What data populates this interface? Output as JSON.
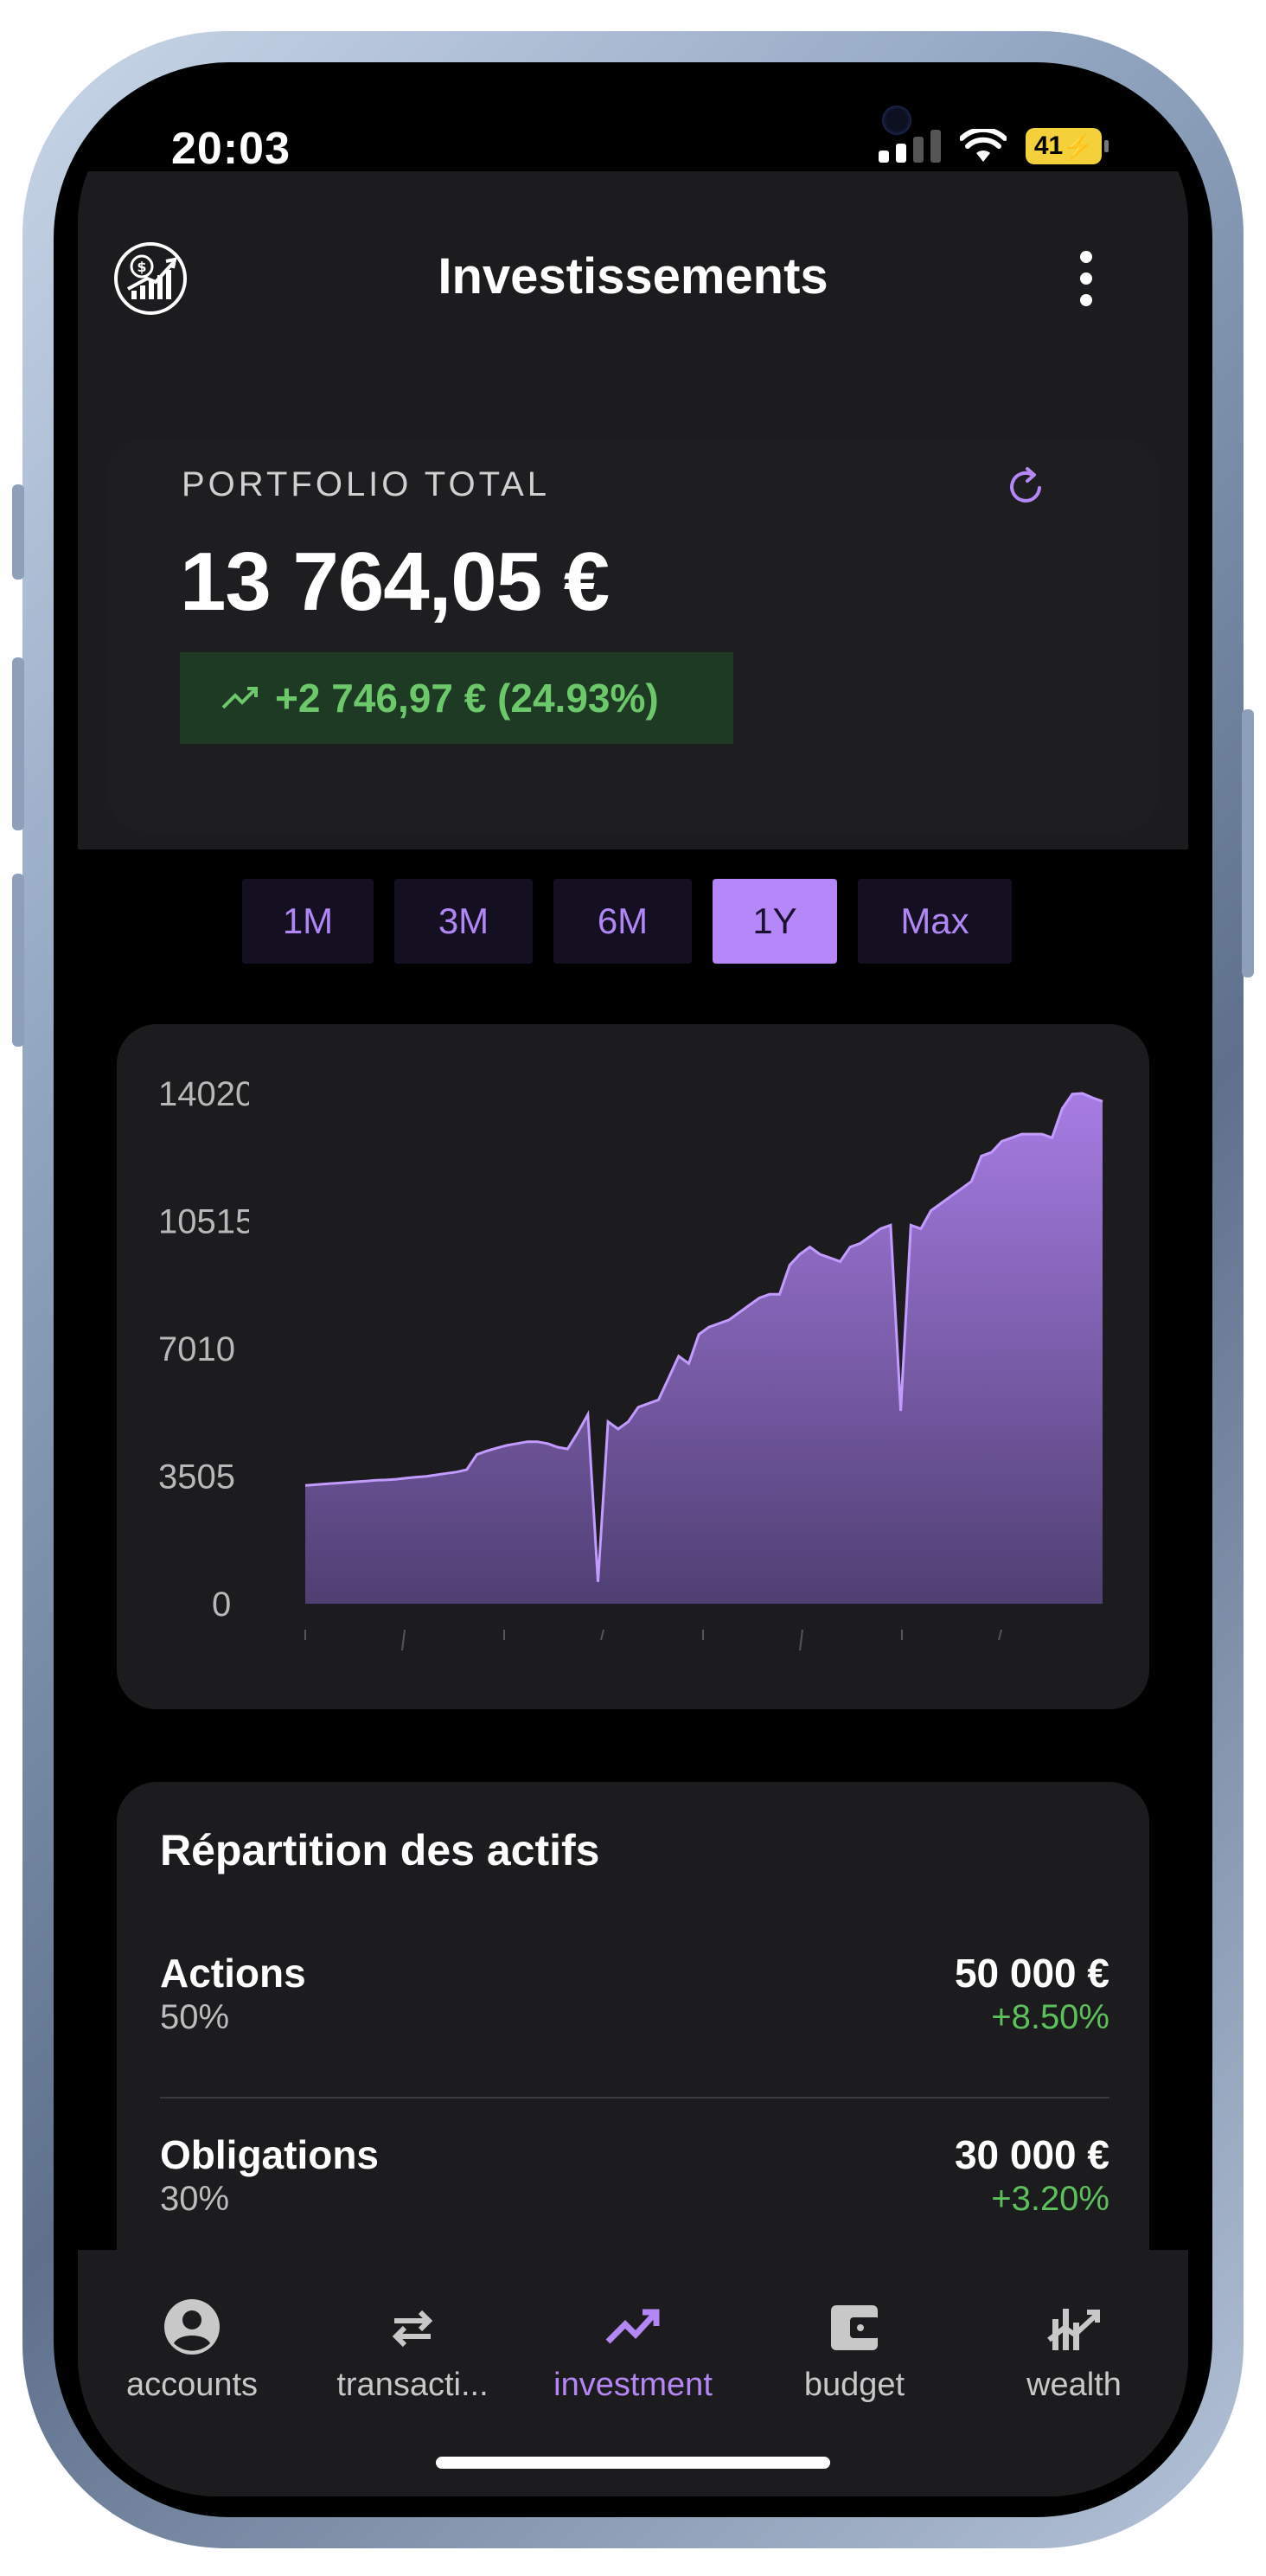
{
  "status_bar": {
    "time": "20:03",
    "battery": "41"
  },
  "header": {
    "title": "Investissements"
  },
  "portfolio": {
    "label": "PORTFOLIO TOTAL",
    "total": "13 764,05 €",
    "gain": "+2 746,97 € (24.93%)"
  },
  "range_tabs": [
    {
      "label": "1M",
      "active": false
    },
    {
      "label": "3M",
      "active": false
    },
    {
      "label": "6M",
      "active": false
    },
    {
      "label": "1Y",
      "active": true
    },
    {
      "label": "Max",
      "active": false
    }
  ],
  "chart_data": {
    "type": "area",
    "y_ticks": [
      "14020",
      "10515",
      "7010",
      "3505",
      "0"
    ],
    "ylim": [
      0,
      14020
    ],
    "color": "#b687f8",
    "values": [
      3250,
      3270,
      3290,
      3310,
      3330,
      3350,
      3370,
      3390,
      3400,
      3420,
      3450,
      3480,
      3500,
      3540,
      3580,
      3620,
      3680,
      4100,
      4200,
      4280,
      4350,
      4400,
      4450,
      4450,
      4400,
      4300,
      4250,
      4700,
      5200,
      600,
      5000,
      4800,
      5000,
      5400,
      5500,
      5600,
      6200,
      6800,
      6600,
      7400,
      7600,
      7700,
      7800,
      8000,
      8200,
      8400,
      8500,
      8500,
      9300,
      9600,
      9800,
      9600,
      9500,
      9400,
      9800,
      9900,
      10100,
      10300,
      10400,
      5300,
      10400,
      10300,
      10800,
      11000,
      11200,
      11400,
      11600,
      12300,
      12400,
      12700,
      12800,
      12900,
      12900,
      12900,
      12800,
      13600,
      14000,
      14020,
      13900,
      13800
    ]
  },
  "allocation": {
    "title": "Répartition des actifs",
    "items": [
      {
        "name": "Actions",
        "percent": "50%",
        "amount": "50 000 €",
        "change": "+8.50%"
      },
      {
        "name": "Obligations",
        "percent": "30%",
        "amount": "30 000 €",
        "change": "+3.20%"
      }
    ]
  },
  "bottom_nav": [
    {
      "label": "accounts",
      "icon": "account-circle-icon",
      "active": false
    },
    {
      "label": "transacti...",
      "icon": "swap-arrows-icon",
      "active": false
    },
    {
      "label": "investment",
      "icon": "trending-up-icon",
      "active": true
    },
    {
      "label": "budget",
      "icon": "wallet-icon",
      "active": false
    },
    {
      "label": "wealth",
      "icon": "wealth-chart-icon",
      "active": false
    }
  ]
}
